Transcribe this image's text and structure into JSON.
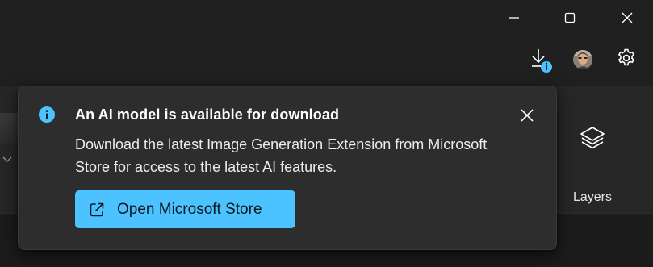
{
  "window": {
    "controls": {
      "minimize_icon": "minimize-icon",
      "maximize_icon": "maximize-icon",
      "close_icon": "close-icon"
    }
  },
  "toolbar": {
    "download_icon": "download-with-info-badge-icon",
    "avatar": "user-avatar",
    "settings_icon": "gear-icon"
  },
  "ribbon": {
    "layers_label": "Layers"
  },
  "popup": {
    "title": "An AI model is available for download",
    "body": "Download the latest Image Generation Extension from Microsoft Store for access to the latest AI features.",
    "button_label": "Open Microsoft Store",
    "info_icon": "info-icon",
    "close_icon": "close-icon"
  },
  "colors": {
    "accent": "#4cc2ff",
    "background": "#202020",
    "popup_background": "#2d2d2d"
  }
}
